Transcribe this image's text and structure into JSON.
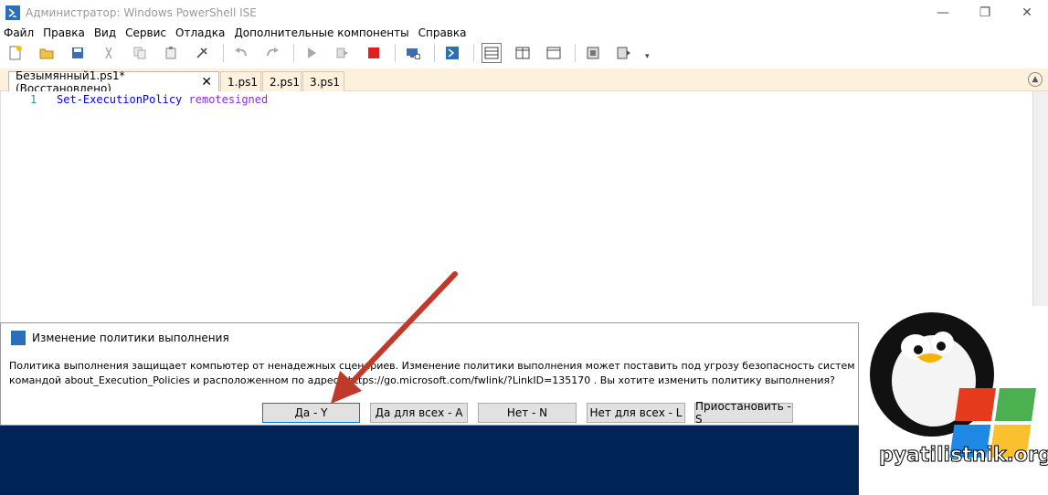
{
  "window": {
    "title": "Администратор: Windows PowerShell ISE",
    "minimize": "—",
    "restore": "❐",
    "close": "✕"
  },
  "menu": [
    "Файл",
    "Правка",
    "Вид",
    "Сервис",
    "Отладка",
    "Дополнительные компоненты",
    "Справка"
  ],
  "toolbar": {
    "icons": [
      "new-file-icon",
      "open-file-icon",
      "save-icon",
      "cut-icon",
      "copy-icon",
      "paste-icon",
      "clear-icon",
      "undo-icon",
      "redo-icon",
      "run-icon",
      "run-selection-icon",
      "stop-icon",
      "remote-powershell-icon",
      "powershell-console-icon",
      "layout-top-icon",
      "layout-right-icon",
      "layout-max-icon",
      "snippets-icon",
      "commands-icon"
    ]
  },
  "tabs": [
    {
      "label": "Безымянный1.ps1*(Восстановлено)",
      "active": true
    },
    {
      "label": "1.ps1",
      "active": false
    },
    {
      "label": "2.ps1",
      "active": false
    },
    {
      "label": "3.ps1",
      "active": false
    }
  ],
  "editor": {
    "line_number": "1",
    "command": "Set-ExecutionPolicy",
    "argument": "remotesigned"
  },
  "dialog": {
    "title": "Изменение политики выполнения",
    "message_line1": "Политика выполнения защищает компьютер от ненадежных сценариев. Изменение политики выполнения может поставить под угрозу безопасность системы, как опис",
    "message_line2": "командой about_Execution_Policies и расположенном по адресу https://go.microsoft.com/fwlink/?LinkID=135170 . Вы хотите изменить политику выполнения?",
    "buttons": {
      "yes": "Да - Y",
      "yes_all": "Да для всех - A",
      "no": "Нет - N",
      "no_all": "Нет для всех - L",
      "suspend": "Приостановить - S"
    }
  },
  "watermark": {
    "text": "pyatilistnik.org"
  },
  "colors": {
    "console_bg": "#012456",
    "tab_strip": "#fdf1de",
    "arrow": "#c0392b"
  }
}
